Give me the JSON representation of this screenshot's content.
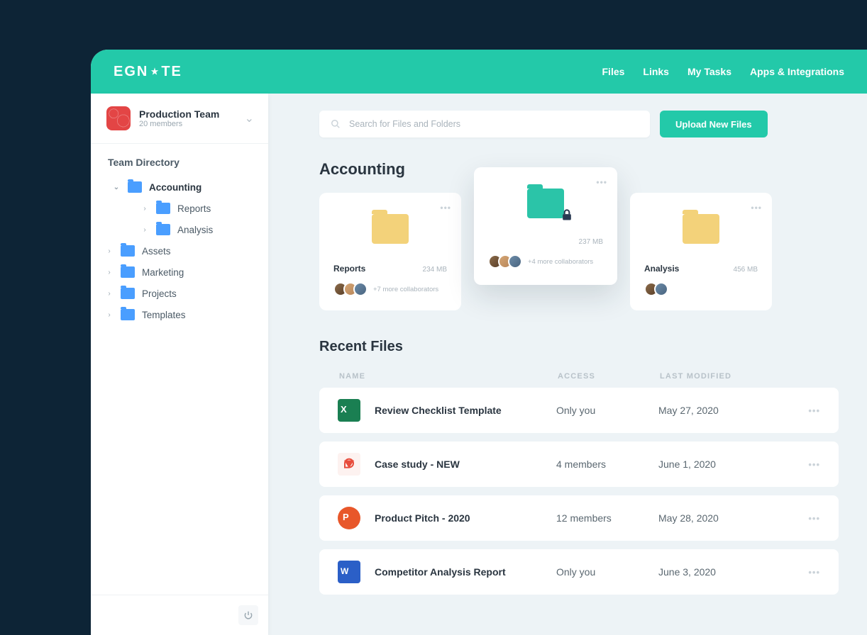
{
  "brand": "EGNYTE",
  "nav": [
    "Files",
    "Links",
    "My Tasks",
    "Apps & Integrations"
  ],
  "sidebar": {
    "team": {
      "name": "Production Team",
      "members": "20 members"
    },
    "sectionLabel": "Team Directory",
    "tree": {
      "accounting": "Accounting",
      "reports": "Reports",
      "analysis": "Analysis",
      "assets": "Assets",
      "marketing": "Marketing",
      "projects": "Projects",
      "templates": "Templates"
    }
  },
  "search": {
    "placeholder": "Search for Files and Folders"
  },
  "uploadLabel": "Upload New Files",
  "pageTitle": "Accounting",
  "folderCards": {
    "reports": {
      "title": "Reports",
      "size": "234 MB",
      "collab": "+7 more collaborators"
    },
    "locked": {
      "size": "237 MB",
      "collab": "+4 more collaborators"
    },
    "analysis": {
      "title": "Analysis",
      "size": "456 MB"
    }
  },
  "recent": {
    "title": "Recent Files",
    "columns": {
      "name": "NAME",
      "access": "ACCESS",
      "modified": "LAST MODIFIED"
    },
    "rows": [
      {
        "name": "Review Checklist Template",
        "access": "Only you",
        "modified": "May 27, 2020"
      },
      {
        "name": "Case study - NEW",
        "access": "4 members",
        "modified": "June 1, 2020"
      },
      {
        "name": "Product Pitch - 2020",
        "access": "12 members",
        "modified": "May 28, 2020"
      },
      {
        "name": "Competitor Analysis Report",
        "access": "Only you",
        "modified": "June 3, 2020"
      }
    ]
  }
}
